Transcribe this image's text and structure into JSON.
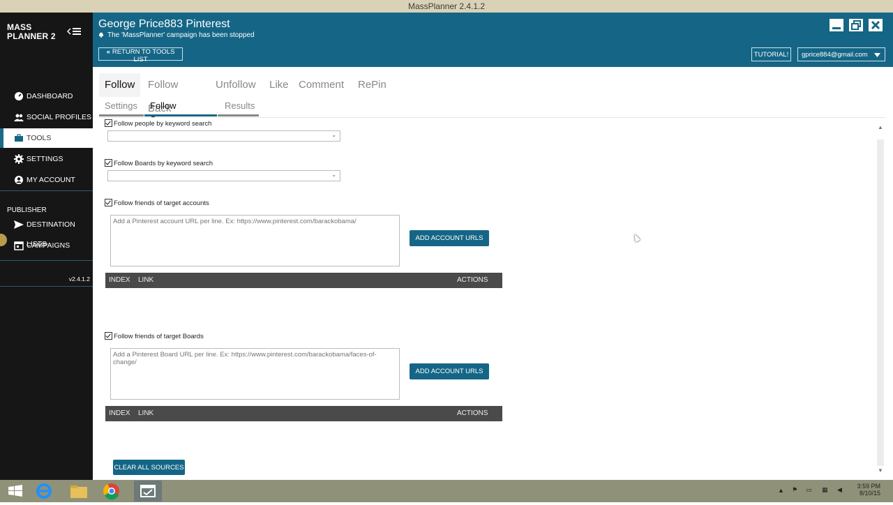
{
  "window": {
    "title": "MassPlanner 2.4.1.2"
  },
  "sidebar": {
    "brand_line1": "MASS",
    "brand_line2": "PLANNER 2",
    "items": [
      {
        "label": "DASHBOARD",
        "icon": "dashboard-icon"
      },
      {
        "label": "SOCIAL PROFILES",
        "icon": "users-icon"
      },
      {
        "label": "TOOLS",
        "icon": "briefcase-icon",
        "active": true
      },
      {
        "label": "SETTINGS",
        "icon": "gear-icon"
      },
      {
        "label": "MY ACCOUNT",
        "icon": "account-icon"
      }
    ],
    "publisher_label": "PUBLISHER",
    "publisher_items": [
      {
        "label": "DESTINATION LISTS",
        "icon": "send-icon"
      },
      {
        "label": "CAMPAIGNS",
        "icon": "calendar-icon"
      }
    ],
    "version": "v2.4.1.2"
  },
  "header": {
    "title": "George Price883 Pinterest",
    "status": "The 'MassPlanner' campaign has been stopped",
    "return_label": "RETURN TO TOOLS LIST",
    "tutorial_label": "TUTORIAL!",
    "account_email": "gprice884@gmail.com"
  },
  "tabs": [
    "Follow",
    "Follow Back",
    "Unfollow",
    "Like",
    "Comment",
    "RePin"
  ],
  "subtabs": [
    "Settings",
    "Follow Sources",
    "Results"
  ],
  "sources": {
    "people_keyword_label": "Follow people by keyword search",
    "boards_keyword_label": "Follow Boards by keyword search",
    "friends_accounts_label": "Follow friends of target accounts",
    "friends_accounts_placeholder": "Add a Pinterest account URL per line. Ex: https://www.pinterest.com/barackobama/",
    "friends_boards_label": "Follow friends of target Boards",
    "friends_boards_placeholder": "Add a Pinterest Board URL per line. Ex: https://www.pinterest.com/barackobama/faces-of-change/",
    "add_button_label": "ADD ACCOUNT URLS",
    "table_columns": [
      "INDEX",
      "LINK",
      "ACTIONS"
    ],
    "clear_label": "CLEAR ALL SOURCES"
  },
  "taskbar": {
    "time": "3:59 PM",
    "date": "8/10/15"
  },
  "colors": {
    "accent": "#156686",
    "sidebar_bg": "#161616",
    "table_header": "#4a4a4a"
  }
}
